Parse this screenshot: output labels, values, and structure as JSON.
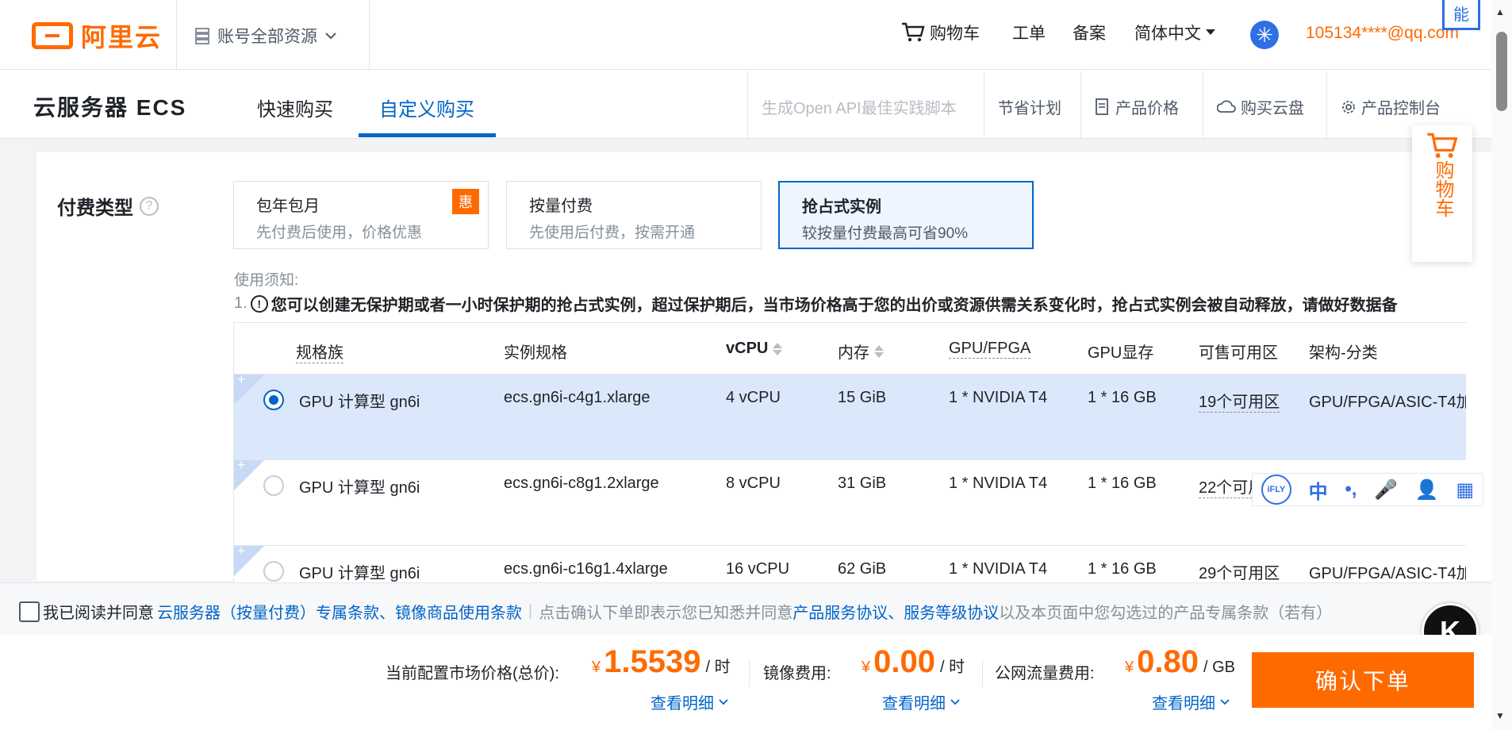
{
  "topnav": {
    "logo_text": "阿里云",
    "account_label": "账号全部资源",
    "cart": "购物车",
    "ticket": "工单",
    "filing": "备案",
    "language": "简体中文",
    "email": "105134****@qq.com",
    "side_tag": "能"
  },
  "subnav": {
    "product_title": "云服务器 ECS",
    "tabs": [
      {
        "label": "快速购买"
      },
      {
        "label": "自定义购买"
      }
    ],
    "tools": {
      "openapi": "生成Open API最佳实践脚本",
      "saving": "节省计划",
      "price": "产品价格",
      "disk": "购买云盘",
      "console": "产品控制台"
    }
  },
  "billing": {
    "label": "付费类型",
    "help": "?",
    "options": [
      {
        "title": "包年包月",
        "desc": "先付费后使用，价格优惠",
        "badge": "惠"
      },
      {
        "title": "按量付费",
        "desc": "先使用后付费，按需开通"
      },
      {
        "title": "抢占式实例",
        "desc": "较按量付费最高可省90%"
      }
    ],
    "notice_title": "使用须知:",
    "notice_num": "1.",
    "notice_text": "您可以创建无保护期或者一小时保护期的抢占式实例，超过保护期后，当市场价格高于您的出价或资源供需关系变化时，抢占式实例会被自动释放，请做好数据备"
  },
  "table": {
    "headers": [
      "规格族",
      "实例规格",
      "vCPU",
      "内存",
      "GPU/FPGA",
      "GPU显存",
      "可售可用区",
      "架构-分类"
    ],
    "rows": [
      {
        "family": "GPU 计算型 gn6i",
        "spec": "ecs.gn6i-c4g1.xlarge",
        "vcpu": "4 vCPU",
        "mem": "15 GiB",
        "gpu": "1 * NVIDIA T4",
        "vram": "1 * 16 GB",
        "zones": "19个可用区",
        "arch": "GPU/FPGA/ASIC-T4加"
      },
      {
        "family": "GPU 计算型 gn6i",
        "spec": "ecs.gn6i-c8g1.2xlarge",
        "vcpu": "8 vCPU",
        "mem": "31 GiB",
        "gpu": "1 * NVIDIA T4",
        "vram": "1 * 16 GB",
        "zones": "22个可用",
        "arch": ""
      },
      {
        "family": "GPU 计算型 gn6i",
        "spec": "ecs.gn6i-c16g1.4xlarge",
        "vcpu": "16 vCPU",
        "mem": "62 GiB",
        "gpu": "1 * NVIDIA T4",
        "vram": "1 * 16 GB",
        "zones": "29个可用区",
        "arch": "GPU/FPGA/ASIC-T4加"
      }
    ],
    "expand": "+"
  },
  "ifly": {
    "logo": "iFLY",
    "zh": "中",
    "items": [
      "•,",
      "🎤",
      "👤",
      "▦"
    ]
  },
  "float_cart": {
    "label": "购物车"
  },
  "agreement": {
    "prefix": "我已阅读并同意",
    "link1": "云服务器（按量付费）专属条款",
    "sep1": "、",
    "link2": "镜像商品使用条款",
    "divider": "|",
    "middle": "点击确认下单即表示您已知悉并同意",
    "link3": "产品服务协议",
    "sep2": "、",
    "link4": "服务等级协议",
    "suffix": "以及本页面中您勾选过的产品专属条款（若有）"
  },
  "badge": "K",
  "price": {
    "currency": "¥",
    "detail": "查看明细",
    "market": {
      "label": "当前配置市场价格(总价):",
      "value": "1.5539",
      "unit": "/ 时"
    },
    "image": {
      "label": "镜像费用:",
      "value": "0.00",
      "unit": "/ 时"
    },
    "traffic": {
      "label": "公网流量费用:",
      "value": "0.80",
      "unit": "/ GB"
    },
    "confirm": "确认下单"
  }
}
